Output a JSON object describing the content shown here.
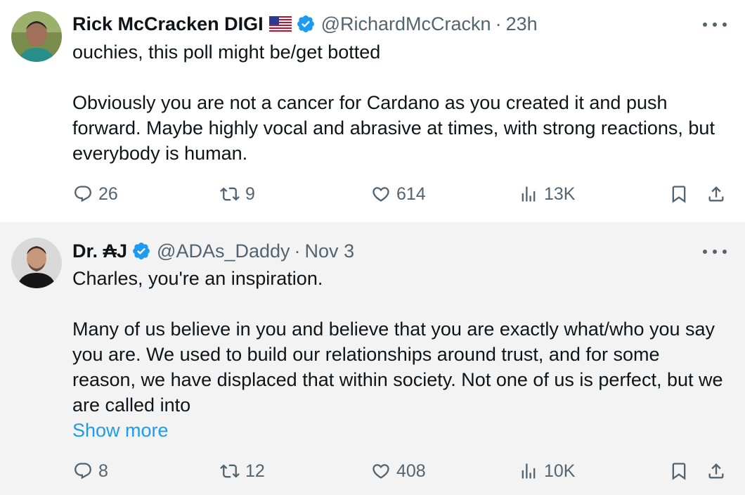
{
  "tweets": [
    {
      "author": {
        "name": "Rick McCracken DIGI",
        "handle": "@RichardMcCrackn",
        "verified": true,
        "flag": "us-flag-icon",
        "avatar": "man-green-shirt-avatar"
      },
      "separator": "·",
      "time": "23h",
      "paragraphs": [
        "ouchies, this poll might be/get botted",
        "Obviously you are not a cancer for Cardano as you created it and push forward. Maybe highly vocal and abrasive at times, with strong reactions, but everybody is human."
      ],
      "show_more": null,
      "stats": {
        "replies": "26",
        "retweets": "9",
        "likes": "614",
        "views": "13K"
      }
    },
    {
      "author": {
        "name": "Dr. ₳J",
        "handle": "@ADAs_Daddy",
        "verified": true,
        "avatar": "man-black-shirt-avatar"
      },
      "separator": "·",
      "time": "Nov 3",
      "paragraphs": [
        "Charles, you're an inspiration.",
        "Many of us believe in you and believe that you are exactly what/who you say you are.  We used to build our relationships around trust, and for some reason, we have displaced that within society.  Not one of us is perfect, but we are called into"
      ],
      "show_more": "Show more",
      "stats": {
        "replies": "8",
        "retweets": "12",
        "likes": "408",
        "views": "10K"
      }
    }
  ],
  "colors": {
    "text": "#0f1419",
    "muted": "#536471",
    "link": "#1d9bf0",
    "verified": "#1d9bf0",
    "tweet2_bg": "#f3f3f3"
  }
}
